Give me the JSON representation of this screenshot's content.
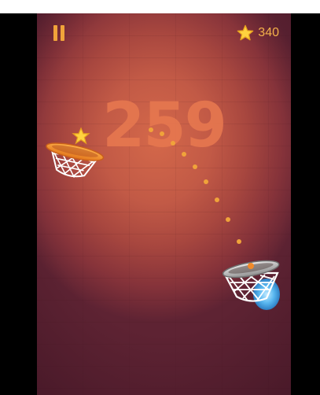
{
  "game": {
    "score": "259",
    "coins": "340"
  },
  "icons": {
    "pause": "pause-icon",
    "coin_star": "star-icon",
    "hoop_star": "star-icon",
    "ball": "basketball-icon"
  },
  "colors": {
    "accent_orange": "#f3a23a",
    "score_color": "#e6774f",
    "background_center": "#d4684a",
    "background_edge": "#5e2333",
    "trajectory_dot": "#f0a33a",
    "active_hoop_rim": "#f08a2a",
    "target_hoop_rim": "#c9c9c9",
    "target_hoop_glow": "#5ab8f0"
  }
}
